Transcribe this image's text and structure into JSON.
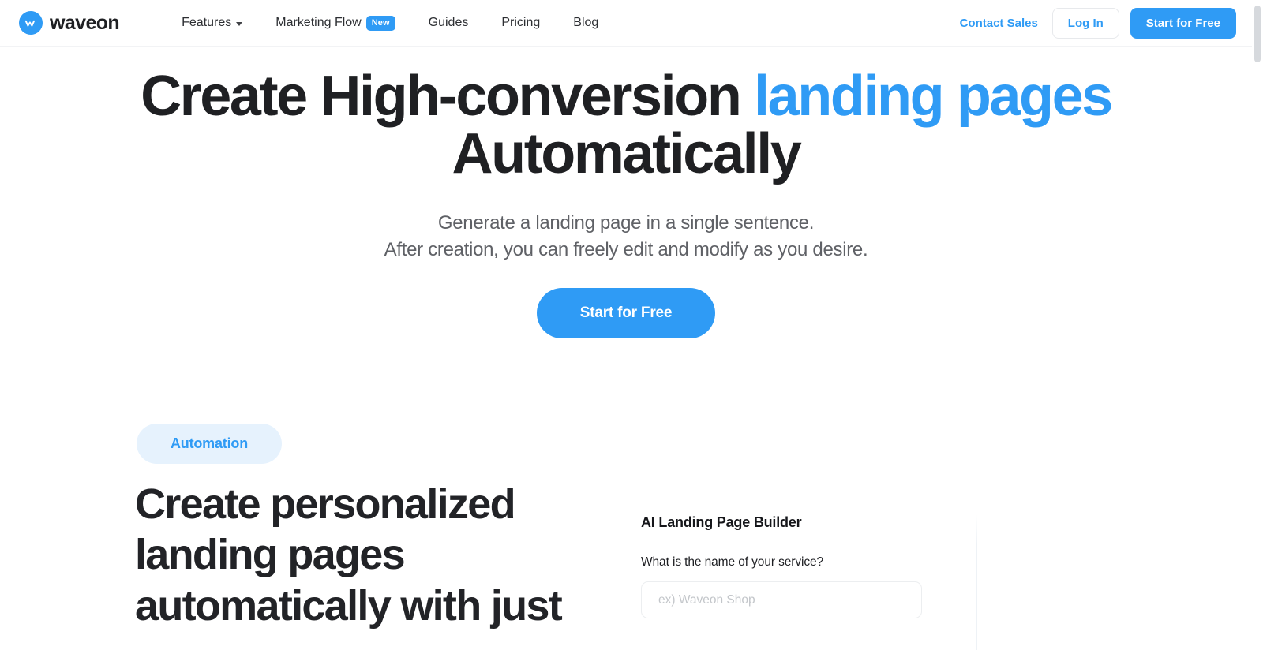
{
  "header": {
    "brand": {
      "name": "waveon",
      "mark_letter": "w"
    },
    "nav": [
      {
        "label": "Features",
        "icon": "chevron-down-icon",
        "has_caret": true,
        "badge": null
      },
      {
        "label": "Marketing Flow",
        "has_caret": false,
        "badge": "New"
      },
      {
        "label": "Guides",
        "has_caret": false,
        "badge": null
      },
      {
        "label": "Pricing",
        "has_caret": false,
        "badge": null
      },
      {
        "label": "Blog",
        "has_caret": false,
        "badge": null
      }
    ],
    "contact_sales": "Contact Sales",
    "login": "Log In",
    "start_free": "Start for Free"
  },
  "hero": {
    "title_line1_part1": "Create High-conversion ",
    "title_line1_accent": "landing pages",
    "title_line2": "Automatically",
    "subtitle_line1": "Generate a landing page in a single sentence.",
    "subtitle_line2": "After creation, you can freely edit and modify as you desire.",
    "cta": "Start for Free"
  },
  "section2": {
    "pill": "Automation",
    "title": "Create personalized landing pages automatically with just",
    "panel": {
      "title": "AI Landing Page Builder",
      "question": "What is the name of your service?",
      "input_value": "",
      "input_placeholder": "ex) Waveon Shop"
    }
  },
  "colors": {
    "accent": "#2f9bf5",
    "pill_bg": "#e6f2fd",
    "text_dark": "#1f2023",
    "text_muted": "#5f6166",
    "border": "#e7e9ec"
  }
}
